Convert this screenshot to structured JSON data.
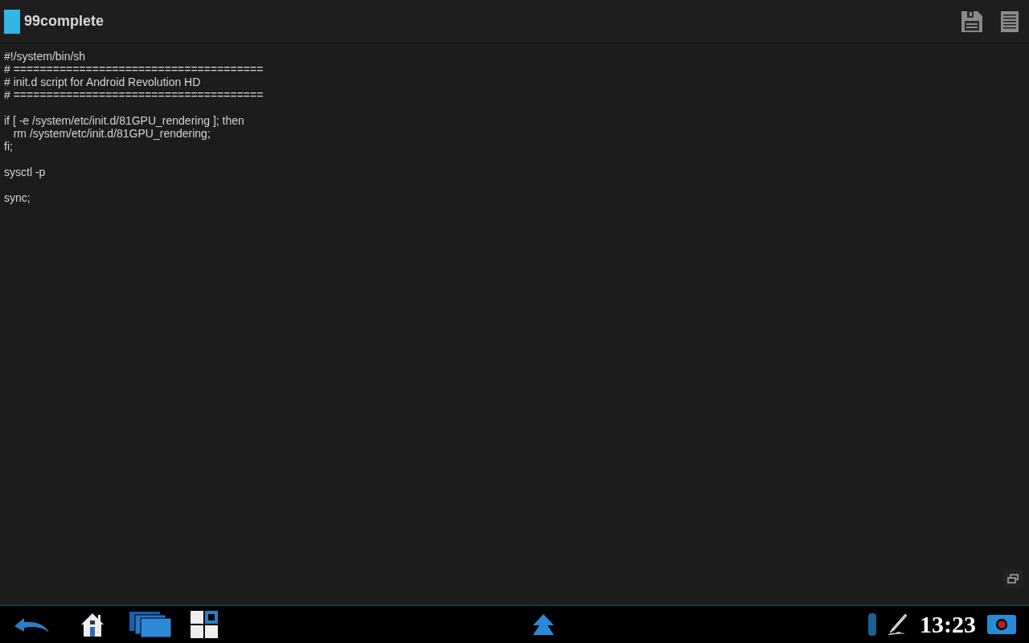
{
  "action_bar": {
    "title": "99complete"
  },
  "editor": {
    "blocks": [
      [
        "#!/system/bin/sh",
        "# ======================================",
        "# init.d script for Android Revolution HD",
        "# ======================================"
      ],
      [
        "if [ -e /system/etc/init.d/81GPU_rendering ]; then",
        "   rm /system/etc/init.d/81GPU_rendering;",
        "fi;"
      ],
      [
        "sysctl -p"
      ],
      [
        "sync;"
      ]
    ]
  },
  "status_bar": {
    "clock": "13:23"
  }
}
